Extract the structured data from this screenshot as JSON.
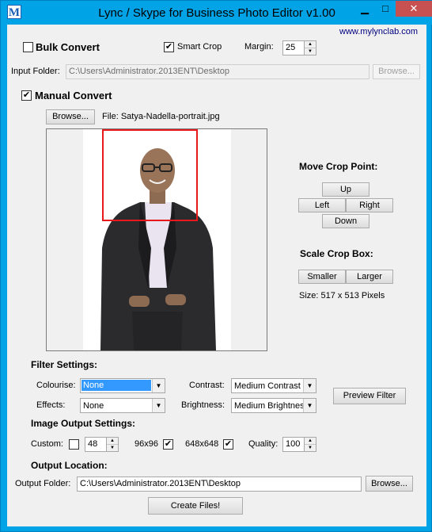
{
  "window": {
    "title": "Lync / Skype for Business Photo Editor v1.00",
    "icon_letter": "M",
    "minimize_glyph": "▁",
    "maximize_glyph": "□",
    "close_glyph": "✕"
  },
  "website": "www.mylynclab.com",
  "bulk": {
    "label": "Bulk Convert",
    "checked_mark": "",
    "smart_crop_label": "Smart Crop",
    "smart_crop_mark": "✔",
    "margin_label": "Margin:",
    "margin_value": "25",
    "input_folder_label": "Input Folder:",
    "input_folder_value": "C:\\Users\\Administrator.2013ENT\\Desktop",
    "browse_label": "Browse..."
  },
  "manual": {
    "label": "Manual Convert",
    "checked_mark": "✔",
    "browse_label": "Browse...",
    "file_text": "File: Satya-Nadella-portrait.jpg"
  },
  "crop": {
    "move_title": "Move Crop Point:",
    "up": "Up",
    "left": "Left",
    "right": "Right",
    "down": "Down",
    "scale_title": "Scale Crop Box:",
    "smaller": "Smaller",
    "larger": "Larger",
    "size_text": "Size: 517 x 513 Pixels"
  },
  "filters": {
    "title": "Filter Settings:",
    "colourise_label": "Colourise:",
    "colourise_value": "None",
    "effects_label": "Effects:",
    "effects_value": "None",
    "contrast_label": "Contrast:",
    "contrast_value": "Medium Contrast E",
    "brightness_label": "Brightness:",
    "brightness_value": "Medium Brightness",
    "preview_button": "Preview Filter"
  },
  "output_settings": {
    "title": "Image Output Settings:",
    "custom_label": "Custom:",
    "custom_mark": "",
    "custom_value": "48",
    "size96_label": "96x96",
    "size96_mark": "✔",
    "size648_label": "648x648",
    "size648_mark": "✔",
    "quality_label": "Quality:",
    "quality_value": "100"
  },
  "output_location": {
    "title": "Output Location:",
    "folder_label": "Output Folder:",
    "folder_value": "C:\\Users\\Administrator.2013ENT\\Desktop",
    "browse_label": "Browse...",
    "create_button": "Create Files!"
  },
  "colors": {
    "titlebar": "#00a3e6",
    "crop_box": "#e8191b",
    "close_button": "#c75050",
    "selection": "#3399ff"
  }
}
